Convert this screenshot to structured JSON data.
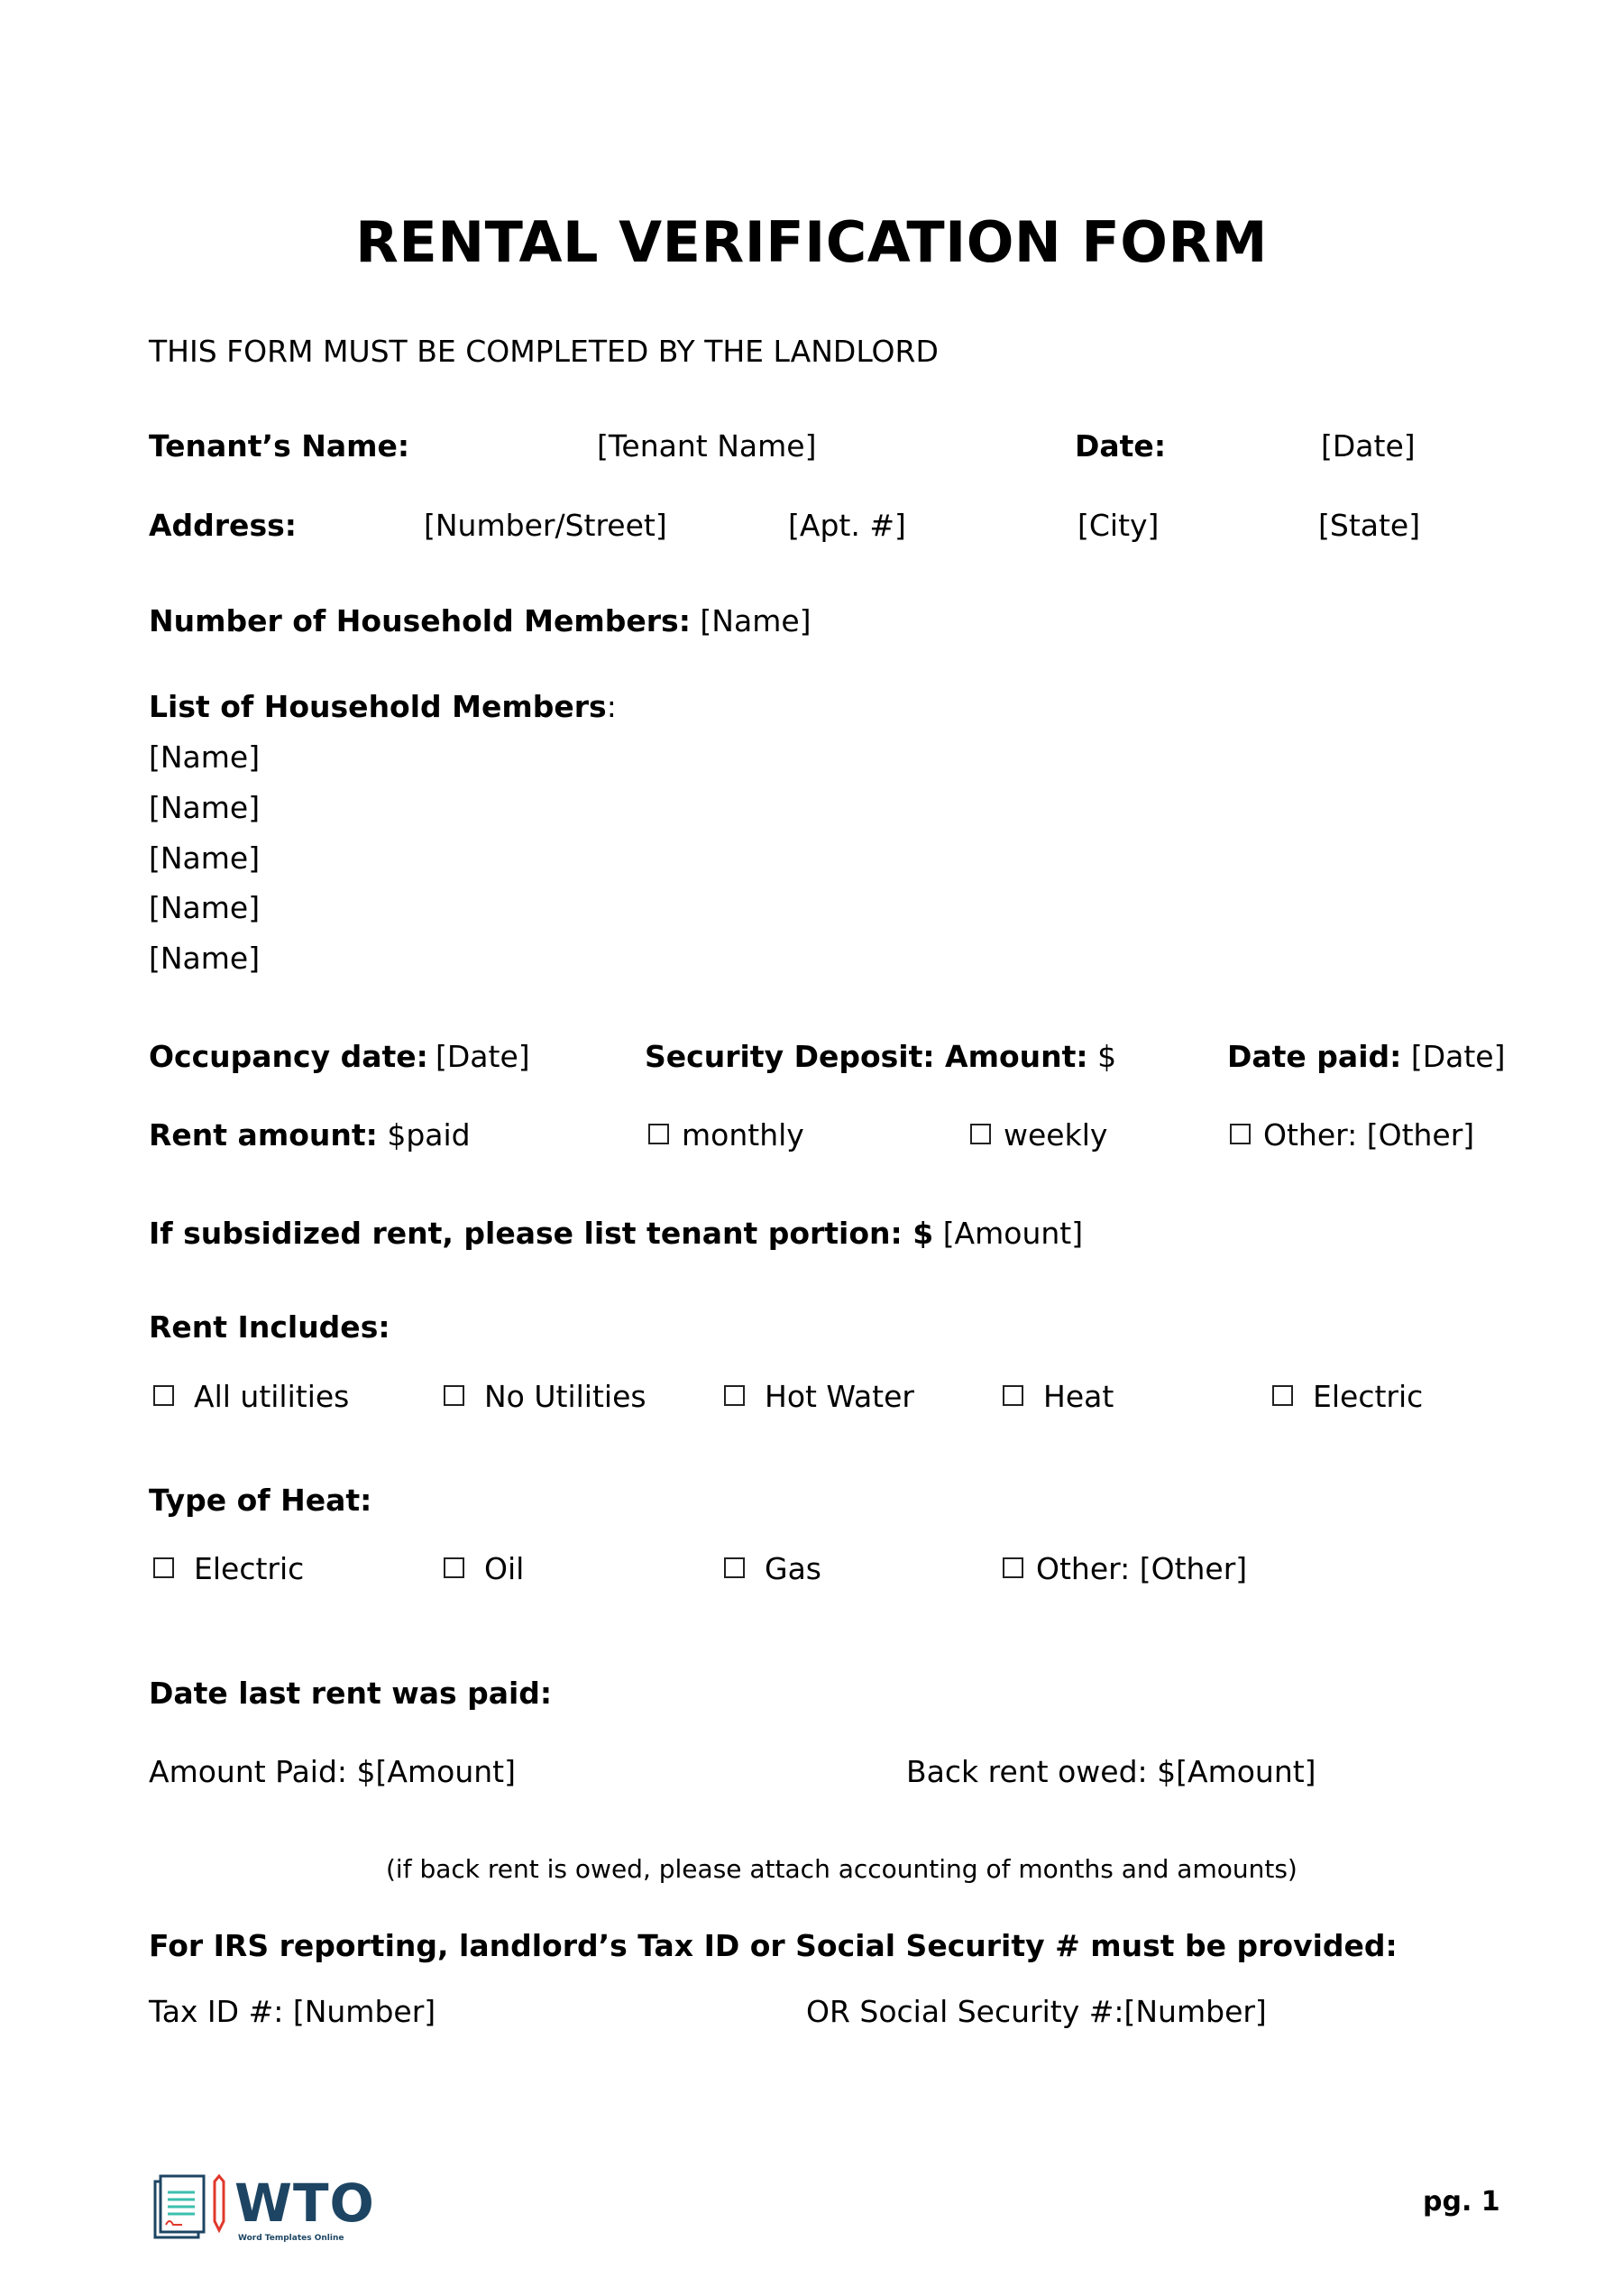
{
  "title": "RENTAL VERIFICATION FORM",
  "subtitle": "THIS FORM MUST BE COMPLETED BY THE LANDLORD",
  "tenant": {
    "name_label": "Tenant’s Name:",
    "name_value": "[Tenant Name]",
    "date_label": "Date:",
    "date_value": "[Date]"
  },
  "address": {
    "label": "Address:",
    "street": "[Number/Street]",
    "apt": "[Apt. #]",
    "city": "[City]",
    "state": "[State]"
  },
  "household": {
    "count_label": "Number of Household Members:",
    "count_value": "[Name]",
    "list_label": "List of Household Members",
    "list_colon": ":",
    "members": [
      "[Name]",
      "[Name]",
      "[Name]",
      "[Name]",
      "[Name]"
    ]
  },
  "occupancy": {
    "label": "Occupancy date:",
    "value": "[Date]",
    "deposit_label": "Security Deposit: Amount:",
    "deposit_value": "$",
    "date_paid_label": "Date paid:",
    "date_paid_value": "[Date]"
  },
  "rent": {
    "label": "Rent amount:",
    "value": "$paid",
    "options": [
      {
        "label": "monthly",
        "checked": false
      },
      {
        "label": "weekly",
        "checked": false
      },
      {
        "label": "Other: [Other]",
        "checked": false
      }
    ]
  },
  "subsidized": {
    "label": "If subsidized rent, please list tenant portion: $",
    "value": "[Amount]"
  },
  "rent_includes": {
    "label": "Rent Includes:",
    "options": [
      {
        "label": "All utilities",
        "checked": false
      },
      {
        "label": "No Utilities",
        "checked": false
      },
      {
        "label": "Hot Water",
        "checked": false
      },
      {
        "label": "Heat",
        "checked": false
      },
      {
        "label": "Electric",
        "checked": false
      }
    ]
  },
  "heat_type": {
    "label": "Type of Heat:",
    "options": [
      {
        "label": "Electric",
        "checked": false
      },
      {
        "label": "Oil",
        "checked": false
      },
      {
        "label": "Gas",
        "checked": false
      },
      {
        "label": "Other: [Other]",
        "checked": false
      }
    ]
  },
  "last_rent": {
    "label": "Date last rent was paid:",
    "amount_paid": "Amount Paid: $[Amount]",
    "back_rent": "Back rent owed: $[Amount]",
    "note": "(if back rent is owed, please attach accounting of months and amounts)"
  },
  "irs": {
    "label": "For IRS reporting, landlord’s Tax ID or Social Security # must be provided:",
    "tax_id": "Tax ID #: [Number]",
    "ssn": "OR Social Security #:[Number]"
  },
  "footer": {
    "logo_text": "WTO",
    "logo_tagline": "Word Templates Online",
    "page": "pg. 1",
    "colors": {
      "navy": "#1d4563",
      "teal": "#3bbfad",
      "red": "#e0382b"
    }
  }
}
